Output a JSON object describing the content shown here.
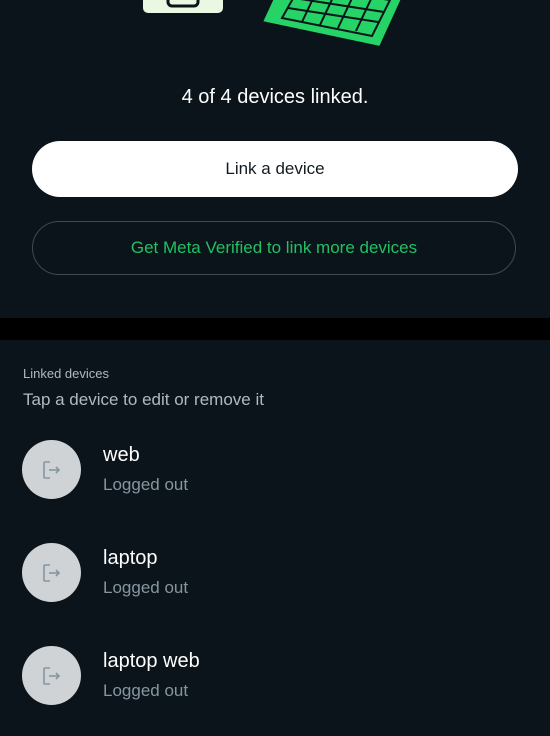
{
  "header": {
    "status_text": "4 of 4 devices linked.",
    "link_button_label": "Link a device",
    "meta_button_label": "Get Meta Verified to link more devices"
  },
  "linked_devices": {
    "title": "Linked devices",
    "subtitle": "Tap a device to edit or remove it",
    "items": [
      {
        "name": "web",
        "status": "Logged out",
        "icon": "logout-icon"
      },
      {
        "name": "laptop",
        "status": "Logged out",
        "icon": "logout-icon"
      },
      {
        "name": "laptop web",
        "status": "Logged out",
        "icon": "logout-icon"
      }
    ]
  },
  "colors": {
    "background": "#0b141a",
    "accent_green": "#21c063",
    "illustration_green": "#25d366",
    "button_white": "#ffffff",
    "avatar_gray": "#cfd3d6"
  }
}
